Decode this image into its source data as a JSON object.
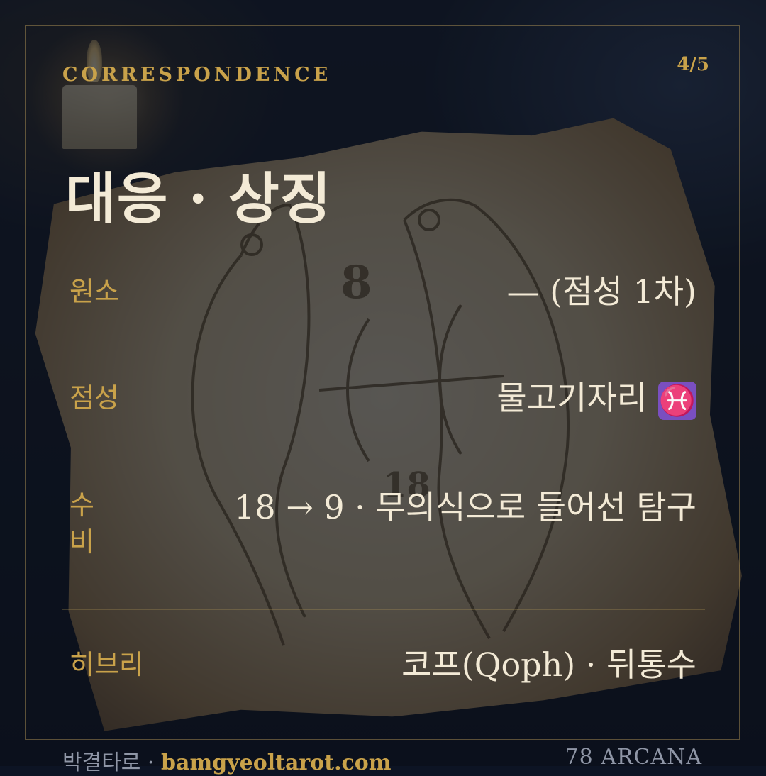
{
  "header": {
    "section_label": "CORRESPONDENCE",
    "page_indicator": "4/5"
  },
  "title": "대응 · 상징",
  "rows": [
    {
      "key": "원소",
      "value": "— (점성 1차)"
    },
    {
      "key": "점성",
      "value": "물고기자리",
      "icon": "pisces-icon",
      "icon_glyph": "♓"
    },
    {
      "key": "수비",
      "value": "18 → 9 · 무의식으로 들어선 탐구"
    },
    {
      "key": "히브리",
      "value": "코프(Qoph) · 뒤통수"
    }
  ],
  "footer": {
    "brand": "박결타로",
    "separator": "·",
    "site": "bamgyeoltarot.com",
    "right": "78 ARCANA"
  },
  "colors": {
    "accent": "#c9a24a",
    "text": "#f3ead6",
    "badge": "#7a4fc0"
  }
}
